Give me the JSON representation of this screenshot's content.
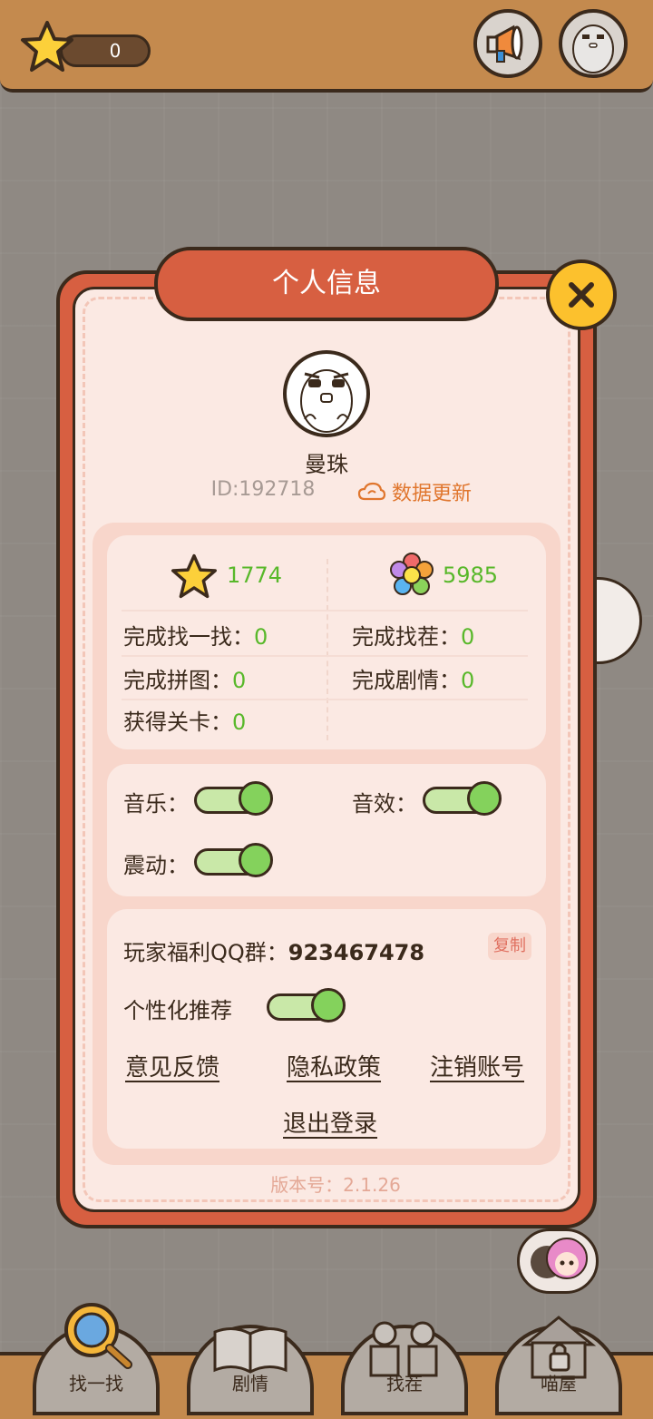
{
  "topbar": {
    "star_count": "0",
    "megaphone_icon": "megaphone-icon",
    "avatar_icon": "avatar-icon"
  },
  "modal": {
    "title": "个人信息",
    "username": "曼珠",
    "user_id": "ID:192718",
    "update_label": "数据更新",
    "stats": {
      "stars": "1774",
      "flowers": "5985",
      "find_label": "完成找一找：",
      "find_value": "0",
      "spot_label": "完成找茬：",
      "spot_value": "0",
      "puzzle_label": "完成拼图：",
      "puzzle_value": "0",
      "story_label": "完成剧情：",
      "story_value": "0",
      "levels_label": "获得关卡：",
      "levels_value": "0"
    },
    "settings": {
      "music_label": "音乐：",
      "music_on": true,
      "sfx_label": "音效：",
      "sfx_on": true,
      "vibrate_label": "震动：",
      "vibrate_on": true
    },
    "misc": {
      "qq_group_label": "玩家福利QQ群：",
      "qq_group_number": "923467478",
      "copy_label": "复制",
      "personalized_label": "个性化推荐",
      "personalized_on": true,
      "feedback_label": "意见反馈",
      "privacy_label": "隐私政策",
      "delete_account_label": "注销账号",
      "logout_label": "退出登录"
    },
    "version": "版本号：2.1.26"
  },
  "bottom_nav": [
    {
      "label": "找一找",
      "icon": "magnifier-icon"
    },
    {
      "label": "剧情",
      "icon": "book-icon"
    },
    {
      "label": "找茬",
      "icon": "plant-pots-icon"
    },
    {
      "label": "喵屋",
      "icon": "locked-house-icon"
    }
  ],
  "colors": {
    "accent_red": "#d75f41",
    "panel_bg": "#fbe9e3",
    "value_green": "#58b82a",
    "link_orange": "#e0762e"
  }
}
